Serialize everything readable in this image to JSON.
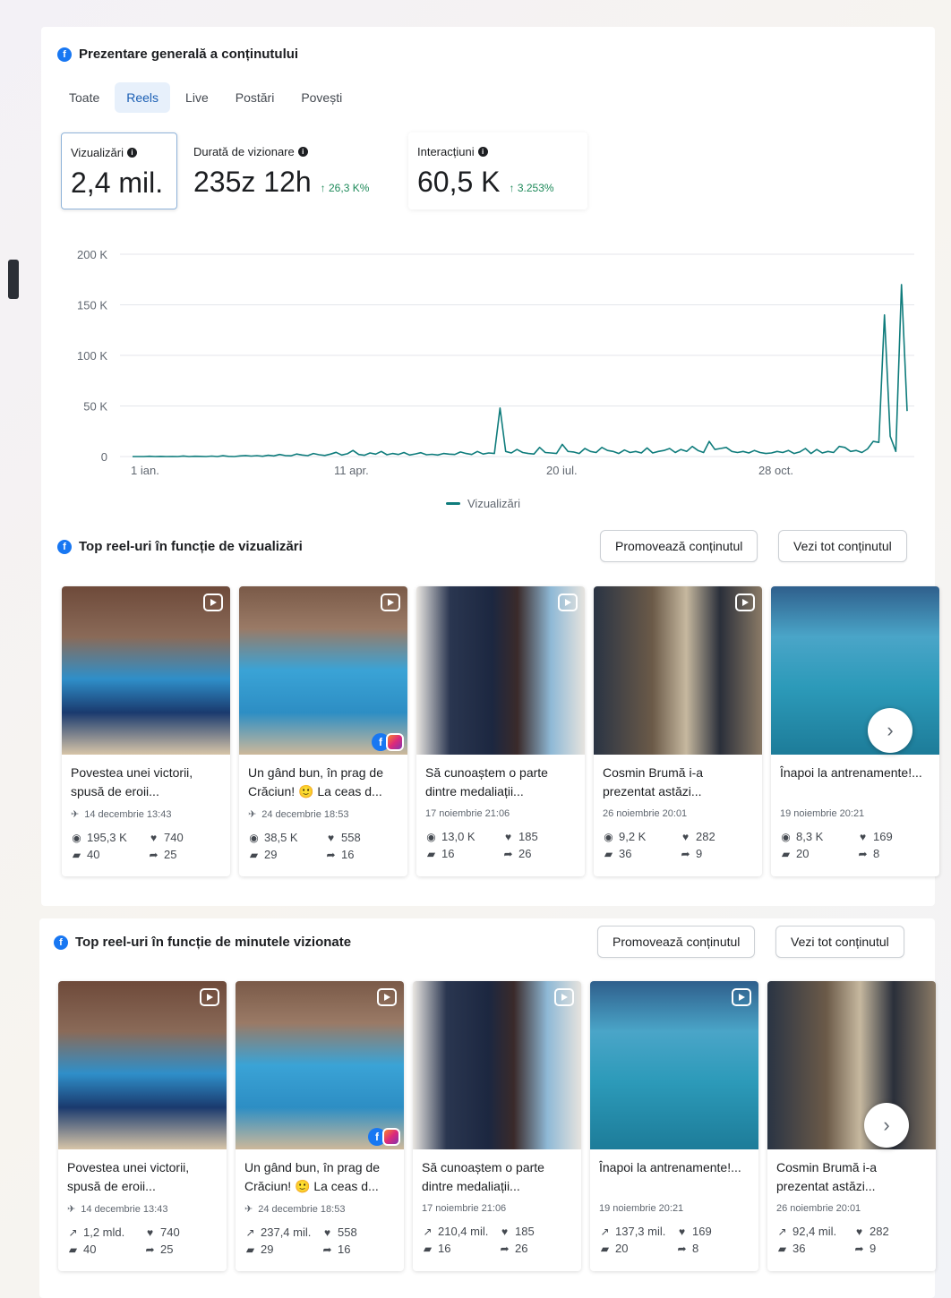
{
  "overview": {
    "title": "Prezentare generală a conținutului",
    "tabs": [
      {
        "label": "Toate",
        "active": false
      },
      {
        "label": "Reels",
        "active": true
      },
      {
        "label": "Live",
        "active": false
      },
      {
        "label": "Postări",
        "active": false
      },
      {
        "label": "Povești",
        "active": false
      }
    ],
    "metrics": [
      {
        "label": "Vizualizări",
        "value": "2,4 mil.",
        "change": ""
      },
      {
        "label": "Durată de vizionare",
        "value": "235z 12h",
        "change": "↑ 26,3 K%"
      },
      {
        "label": "Interacțiuni",
        "value": "60,5 K",
        "change": "↑ 3.253%"
      }
    ]
  },
  "chart_data": {
    "type": "line",
    "title": "",
    "xlabel": "",
    "ylabel": "",
    "ylim": [
      0,
      200000
    ],
    "y_ticks": [
      "200 K",
      "150 K",
      "100 K",
      "50 K",
      "0"
    ],
    "x_ticks": [
      "1 ian.",
      "11 apr.",
      "20 iul.",
      "28 oct."
    ],
    "grid": true,
    "legend_position": "bottom",
    "series": [
      {
        "name": "Vizualizări",
        "color": "#0f7c7c",
        "x_range": [
          "1 ian.",
          "31 dec."
        ],
        "values": [
          0,
          0,
          0,
          300,
          0,
          200,
          0,
          100,
          0,
          500,
          0,
          300,
          200,
          0,
          400,
          0,
          800,
          200,
          0,
          600,
          1000,
          400,
          900,
          300,
          1200,
          600,
          2000,
          1000,
          700,
          2500,
          1500,
          900,
          3000,
          1800,
          1100,
          2400,
          4200,
          1500,
          2700,
          6000,
          2000,
          1200,
          3500,
          2400,
          5000,
          1800,
          3000,
          2000,
          4000,
          1500,
          2600,
          3800,
          1800,
          2200,
          1500,
          3000,
          2400,
          2000,
          4500,
          3000,
          2000,
          5000,
          2500,
          3500,
          3000,
          48000,
          5000,
          3500,
          7000,
          4000,
          3000,
          2500,
          9000,
          4000,
          3500,
          3000,
          12000,
          5000,
          4500,
          3000,
          8000,
          5000,
          4000,
          9000,
          6000,
          5000,
          3000,
          6500,
          4000,
          5000,
          3500,
          8500,
          3500,
          5000,
          6000,
          8000,
          4000,
          7000,
          5000,
          10000,
          6000,
          4000,
          15000,
          7000,
          8000,
          9000,
          5000,
          4000,
          5000,
          3500,
          6000,
          4000,
          3000,
          3500,
          5000,
          4000,
          6000,
          3000,
          4500,
          8000,
          3000,
          7000,
          3500,
          5000,
          4000,
          10000,
          9000,
          5000,
          6000,
          4000,
          7500,
          15000,
          14000,
          140000,
          20000,
          5000,
          170000,
          45000
        ]
      }
    ]
  },
  "top_views": {
    "title": "Top reel-uri în funcție de vizualizări",
    "promote_label": "Promovează conținutul",
    "view_all_label": "Vezi tot conținutul",
    "cards": [
      {
        "title": "Povestea unei victorii, spusă de eroii...",
        "date": "14 decembrie 13:43",
        "pinned": true,
        "views": "195,3 K",
        "likes": "740",
        "comments": "40",
        "shares": "25"
      },
      {
        "title": "Un gând bun, în prag de Crăciun! 🙂 La ceas d...",
        "date": "24 decembrie 18:53",
        "pinned": true,
        "views": "38,5 K",
        "likes": "558",
        "comments": "29",
        "shares": "16"
      },
      {
        "title": "Să cunoaștem o parte dintre medaliații...",
        "date": "17 noiembrie 21:06",
        "pinned": false,
        "views": "13,0 K",
        "likes": "185",
        "comments": "16",
        "shares": "26"
      },
      {
        "title": "Cosmin Brumă i-a prezentat astăzi...",
        "date": "26 noiembrie 20:01",
        "pinned": false,
        "views": "9,2 K",
        "likes": "282",
        "comments": "36",
        "shares": "9"
      },
      {
        "title": "Înapoi la antrenamente!...",
        "date": "19 noiembrie 20:21",
        "pinned": false,
        "views": "8,3 K",
        "likes": "169",
        "comments": "20",
        "shares": "8"
      }
    ]
  },
  "top_minutes": {
    "title": "Top reel-uri în funcție de minutele vizionate",
    "promote_label": "Promovează conținutul",
    "view_all_label": "Vezi tot conținutul",
    "cards": [
      {
        "title": "Povestea unei victorii, spusă de eroii...",
        "date": "14 decembrie 13:43",
        "pinned": true,
        "minutes": "1,2 mld.",
        "likes": "740",
        "comments": "40",
        "shares": "25"
      },
      {
        "title": "Un gând bun, în prag de Crăciun! 🙂 La ceas d...",
        "date": "24 decembrie 18:53",
        "pinned": true,
        "minutes": "237,4 mil.",
        "likes": "558",
        "comments": "29",
        "shares": "16"
      },
      {
        "title": "Să cunoaștem o parte dintre medaliații...",
        "date": "17 noiembrie 21:06",
        "pinned": false,
        "minutes": "210,4 mil.",
        "likes": "185",
        "comments": "16",
        "shares": "26"
      },
      {
        "title": "Înapoi la antrenamente!...",
        "date": "19 noiembrie 20:21",
        "pinned": false,
        "minutes": "137,3 mil.",
        "likes": "169",
        "comments": "20",
        "shares": "8"
      },
      {
        "title": "Cosmin Brumă i-a prezentat astăzi...",
        "date": "26 noiembrie 20:01",
        "pinned": false,
        "minutes": "92,4 mil.",
        "likes": "282",
        "comments": "36",
        "shares": "9"
      }
    ]
  },
  "icons": {
    "facebook": "facebook-icon",
    "info": "info-icon",
    "reel": "reel-icon",
    "pin": "pin-icon",
    "eye": "eye-icon",
    "heart": "heart-icon",
    "comment": "comment-icon",
    "share": "share-icon",
    "minutes": "trend-icon",
    "next": "chevron-right-icon"
  }
}
